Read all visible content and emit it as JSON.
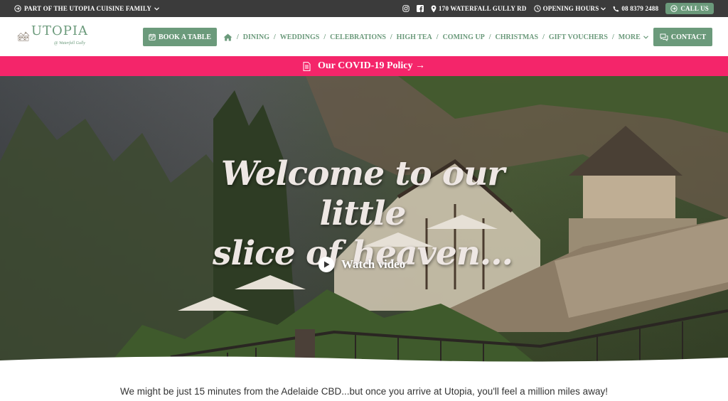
{
  "topbar": {
    "family_label": "PART OF THE UTOPIA CUISINE FAMILY",
    "address": "170 WATERFALL GULLY RD",
    "hours_label": "OPENING HOURS",
    "phone": "08 8379 2488",
    "call_label": "CALL US"
  },
  "logo": {
    "name": "UTOPIA",
    "tagline": "@ Waterfall Gully"
  },
  "header": {
    "book_label": "BOOK A TABLE",
    "contact_label": "CONTACT",
    "nav": [
      "DINING",
      "WEDDINGS",
      "CELEBRATIONS",
      "HIGH TEA",
      "COMING UP",
      "CHRISTMAS",
      "GIFT VOUCHERS",
      "MORE"
    ]
  },
  "banner": {
    "text": "Our COVID-19 Policy →"
  },
  "hero": {
    "headline_line1": "Welcome to our little",
    "headline_line2": "slice of heaven...",
    "watch_label": "Watch video"
  },
  "intro": {
    "text": "We might be just 15 minutes from the Adelaide CBD...but once you arrive at Utopia, you'll feel a million miles away!"
  },
  "colors": {
    "brand_green": "#6b9a7b",
    "topbar_bg": "#3b3b3b",
    "banner_pink": "#f4256a"
  },
  "icons": [
    "arrow-circle-icon",
    "chevron-down-icon",
    "instagram-icon",
    "facebook-icon",
    "map-pin-icon",
    "clock-icon",
    "phone-icon",
    "calendar-icon",
    "home-icon",
    "chat-icon",
    "document-icon",
    "play-icon"
  ]
}
